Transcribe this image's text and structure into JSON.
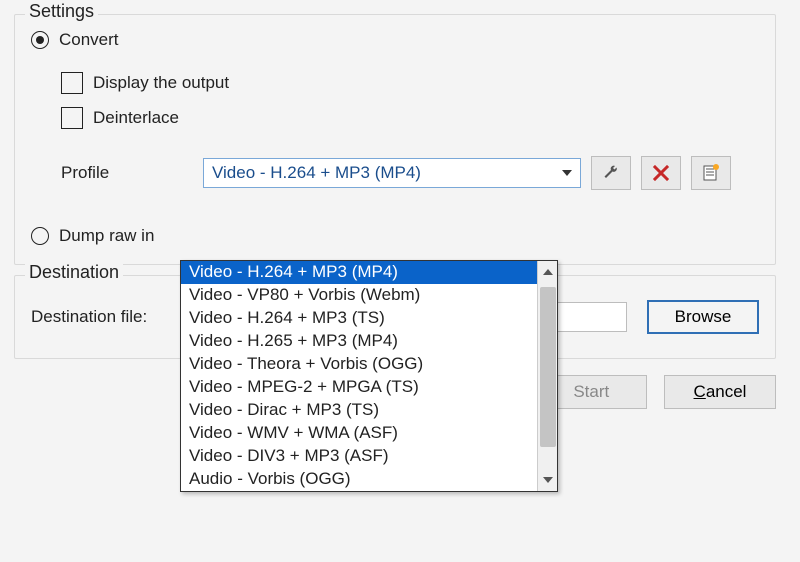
{
  "settings": {
    "legend": "Settings",
    "convert_label": "Convert",
    "display_output_label": "Display the output",
    "deinterlace_label": "Deinterlace",
    "profile_label": "Profile",
    "profile_selected": "Video - H.264 + MP3 (MP4)",
    "dump_raw_label": "Dump raw in",
    "profile_options": [
      "Video - H.264 + MP3 (MP4)",
      "Video - VP80 + Vorbis (Webm)",
      "Video - H.264 + MP3 (TS)",
      "Video - H.265 + MP3 (MP4)",
      "Video - Theora + Vorbis (OGG)",
      "Video - MPEG-2 + MPGA (TS)",
      "Video - Dirac + MP3 (TS)",
      "Video - WMV + WMA (ASF)",
      "Video - DIV3 + MP3 (ASF)",
      "Audio - Vorbis (OGG)"
    ]
  },
  "destination": {
    "legend": "Destination",
    "file_label": "Destination file:",
    "file_value": "",
    "browse_label": "Browse"
  },
  "buttons": {
    "start": "Start",
    "cancel": "ancel",
    "cancel_mnemonic": "C"
  },
  "icons": {
    "edit": "wrench-icon",
    "delete": "x-icon",
    "new": "list-new-icon"
  }
}
